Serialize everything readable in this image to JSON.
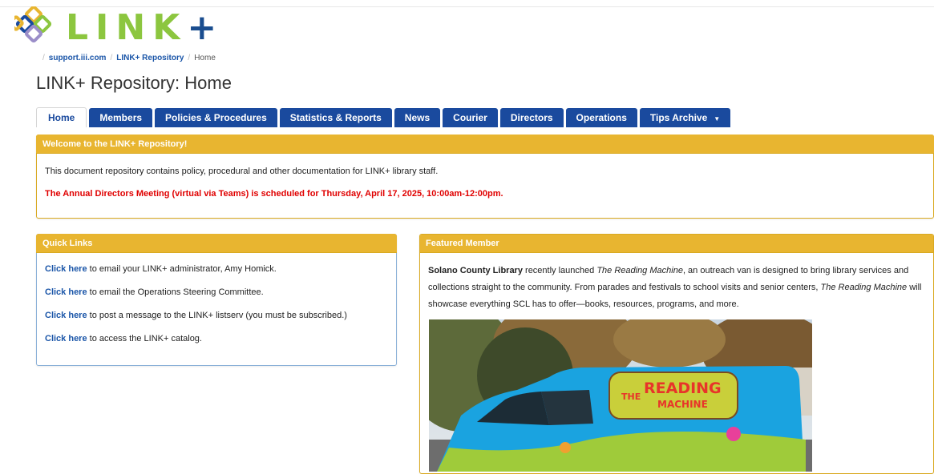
{
  "logo": {
    "letters": "LINK",
    "plus": "+"
  },
  "breadcrumb": {
    "items": [
      "support.iii.com",
      "LINK+ Repository",
      "Home"
    ]
  },
  "page_title": "LINK+ Repository: Home",
  "tabs": [
    {
      "label": "Home",
      "active": true
    },
    {
      "label": "Members"
    },
    {
      "label": "Policies & Procedures"
    },
    {
      "label": "Statistics & Reports"
    },
    {
      "label": "News"
    },
    {
      "label": "Courier"
    },
    {
      "label": "Directors"
    },
    {
      "label": "Operations"
    },
    {
      "label": "Tips Archive",
      "dropdown": true
    }
  ],
  "welcome": {
    "title": "Welcome to the LINK+ Repository!",
    "text": "This document repository contains policy, procedural and other documentation for LINK+ library staff.",
    "alert": "The Annual Directors Meeting (virtual via Teams) is scheduled for Thursday, April 17, 2025, 10:00am-12:00pm."
  },
  "quick_links": {
    "title": "Quick Links",
    "items": [
      {
        "link": "Click here",
        "text": " to email your LINK+ administrator, Amy Homick."
      },
      {
        "link": "Click here",
        "text": " to email the Operations Steering Committee."
      },
      {
        "link": "Click here",
        "text": " to post a message to the LINK+ listserv (you must be subscribed.)"
      },
      {
        "link": "Click here",
        "text": " to access the LINK+ catalog."
      }
    ]
  },
  "featured": {
    "title": "Featured Member",
    "library": "Solano County Library",
    "t1": " recently launched ",
    "name1": "The Reading Machine",
    "t2": ", an outreach van is designed to bring library services and collections straight to the community. From parades and festivals to school visits and senior centers, ",
    "name2": "The Reading Machine",
    "t3": " will showcase everything SCL has to offer—books, resources, programs, and more.",
    "van_sign_the": "THE",
    "van_sign_main": "READING",
    "van_sign_sub": "MACHINE"
  },
  "colors": {
    "tab_blue": "#1a4a9e",
    "panel_gold": "#e8b530",
    "alert_red": "#e00000",
    "logo_green": "#8cc63f"
  }
}
